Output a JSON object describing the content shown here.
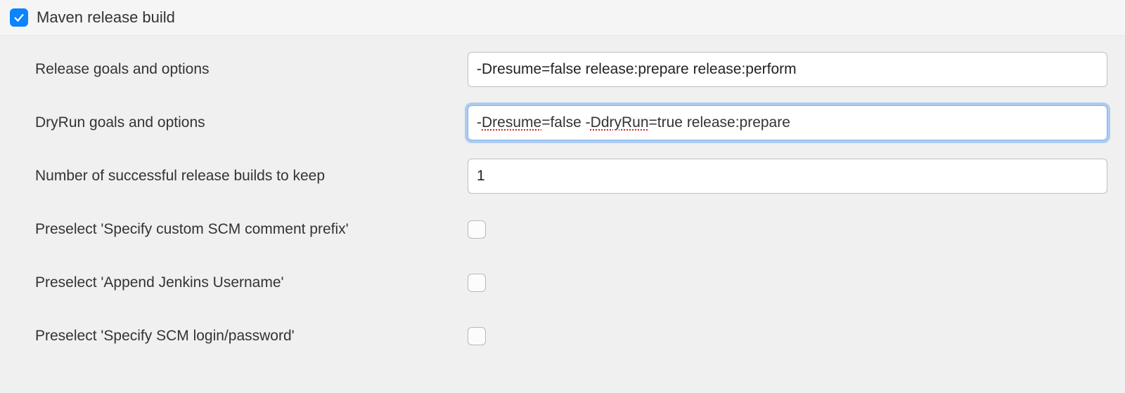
{
  "header": {
    "checked": true,
    "label": "Maven release build"
  },
  "fields": {
    "release_goals": {
      "label": "Release goals and options",
      "value": "-Dresume=false release:prepare release:perform"
    },
    "dryrun_goals": {
      "label": "DryRun goals and options",
      "value": "-Dresume=false -DdryRun=true release:prepare",
      "value_parts": {
        "p1": "-",
        "p2": "Dresume",
        "p3": "=false -",
        "p4": "DdryRun",
        "p5": "=true release:prepare"
      },
      "focused": true
    },
    "keep_builds": {
      "label": "Number of successful release builds to keep",
      "value": "1"
    },
    "preselect_scm_comment": {
      "label": "Preselect 'Specify custom SCM comment prefix'",
      "checked": false
    },
    "preselect_jenkins_user": {
      "label": "Preselect 'Append Jenkins Username'",
      "checked": false
    },
    "preselect_scm_login": {
      "label": "Preselect 'Specify SCM login/password'",
      "checked": false
    }
  }
}
